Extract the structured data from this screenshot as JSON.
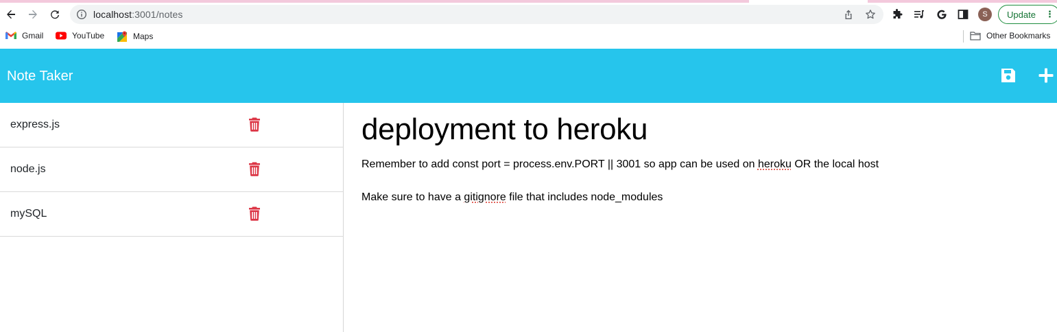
{
  "browser": {
    "url_host": "localhost",
    "url_rest": ":3001/notes",
    "avatar_letter": "S",
    "update_label": "Update",
    "icons": [
      "back-icon",
      "forward-icon",
      "reload-icon",
      "info-icon",
      "share-icon",
      "star-icon",
      "puzzle-icon",
      "playlist-icon",
      "google-icon",
      "sidepanel-icon",
      "kebab-icon"
    ]
  },
  "bookmarks": {
    "items": [
      {
        "label": "Gmail",
        "icon": "gmail-icon"
      },
      {
        "label": "YouTube",
        "icon": "youtube-icon"
      },
      {
        "label": "Maps",
        "icon": "maps-icon"
      }
    ],
    "other_label": "Other Bookmarks"
  },
  "app": {
    "title": "Note Taker",
    "header_color": "#26c5ec",
    "accent_delete": "#dc3545",
    "actions": [
      "save-icon",
      "plus-icon"
    ]
  },
  "notes": [
    {
      "title": "express.js"
    },
    {
      "title": "node.js"
    },
    {
      "title": "mySQL"
    }
  ],
  "active_note": {
    "title": "deployment to heroku",
    "line1_a": "Remember to add const port = process.env.PORT || 3001 so app can be used on ",
    "line1_b": "heroku",
    "line1_c": " OR the local host",
    "line2_a": "Make sure to have a ",
    "line2_b": "gitignore",
    "line2_c": " file that includes node_modules"
  }
}
